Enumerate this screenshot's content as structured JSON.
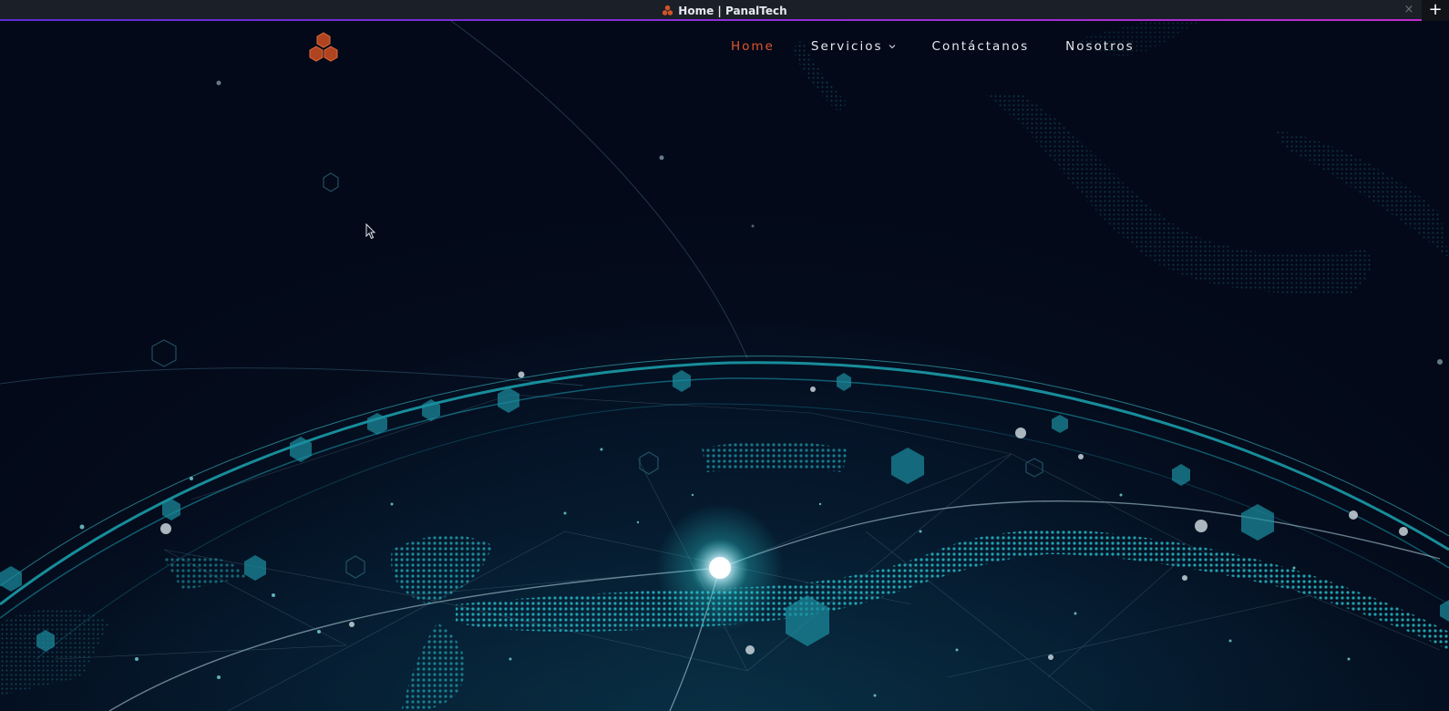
{
  "browser": {
    "tab_title": "Home | PanalTech",
    "close_label": "×",
    "newtab_label": "+"
  },
  "site": {
    "logo_icon": "hexagon-cluster-logo",
    "brand_color": "#d0532a"
  },
  "nav": {
    "items": [
      {
        "label": "Home",
        "active": true
      },
      {
        "label": "Servicios",
        "dropdown": true
      },
      {
        "label": "Contáctanos"
      },
      {
        "label": "Nosotros"
      }
    ]
  },
  "colors": {
    "background": "#040a18",
    "globe_glow": "#2ad4d9",
    "nav_active": "#e0562c",
    "nav_text": "#e6e8ee"
  }
}
